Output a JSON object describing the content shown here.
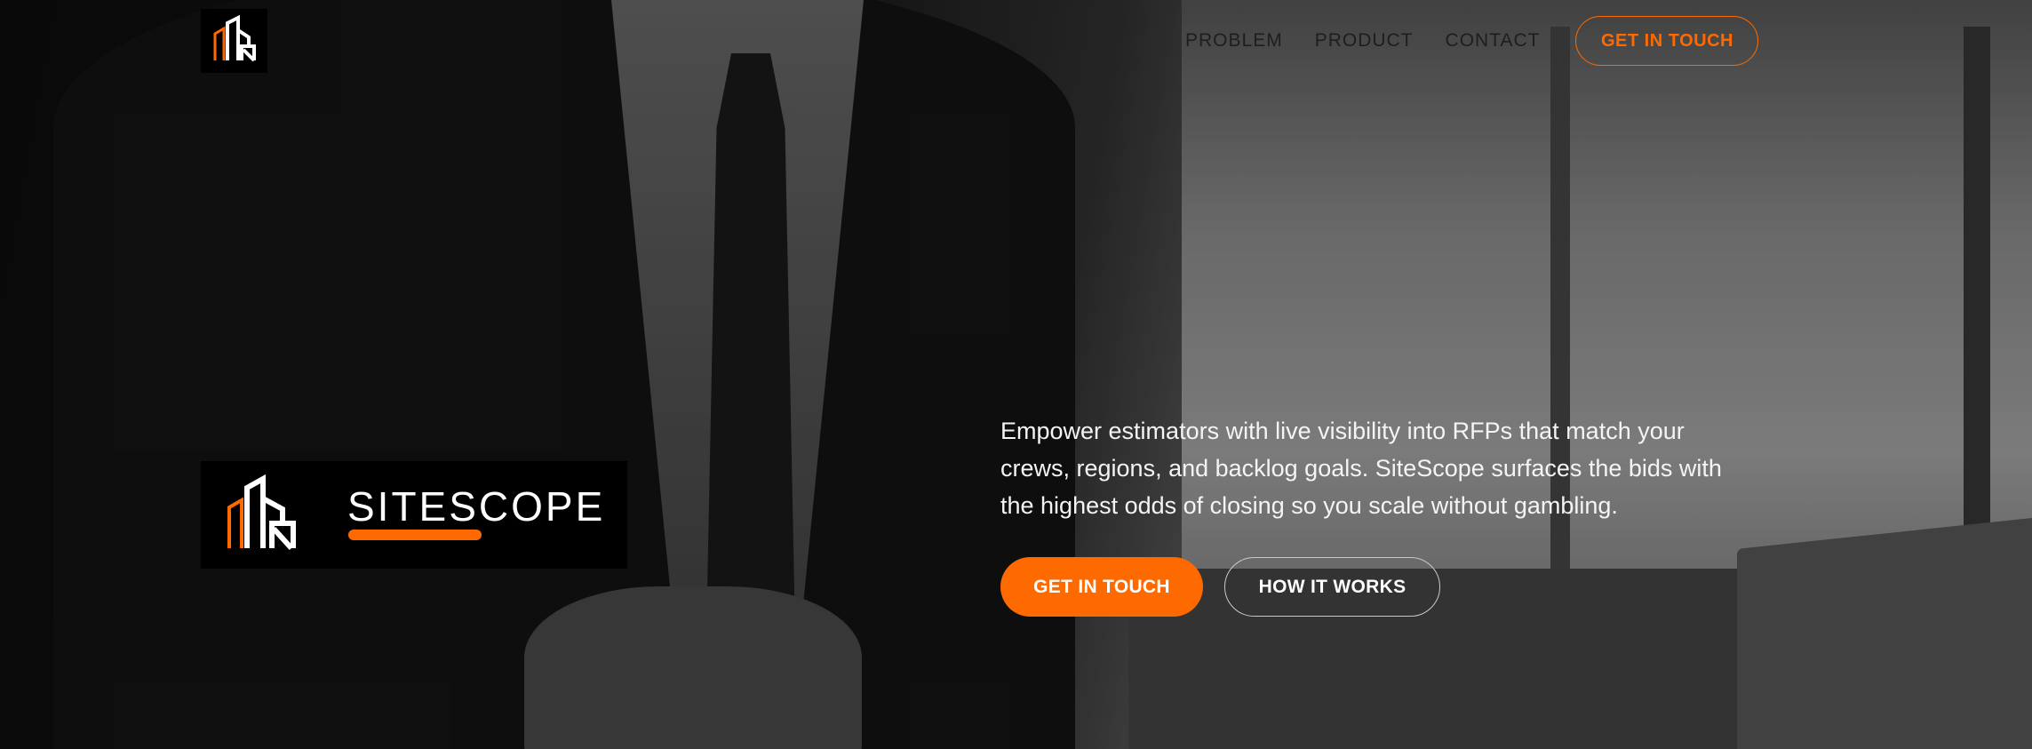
{
  "nav": {
    "logo_icon": "building-logo-icon",
    "links": [
      {
        "label": "PROBLEM"
      },
      {
        "label": "PRODUCT"
      },
      {
        "label": "CONTACT"
      }
    ],
    "cta_label": "GET IN TOUCH"
  },
  "brand": {
    "name": "SITESCOPE",
    "logo_icon": "building-logo-icon"
  },
  "hero": {
    "copy": "Empower estimators with live visibility into RFPs that match your crews, regions, and backlog goals. SiteScope surfaces the bids with the highest odds of closing so you scale without gambling.",
    "primary_cta": "GET IN TOUCH",
    "secondary_cta": "HOW IT WORKS",
    "background_image": "businessman-buttoning-suit-photo"
  },
  "colors": {
    "accent": "#ff6a00",
    "logo_background": "#000000",
    "text_light": "#ffffff",
    "nav_text": "#1e1e1e"
  }
}
